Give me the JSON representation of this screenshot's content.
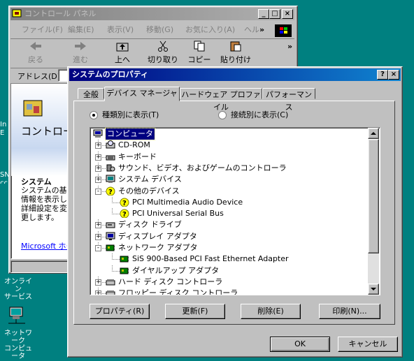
{
  "cp_window": {
    "title": "コントロール パネル",
    "menu": [
      "ファイル(F)",
      "編集(E)",
      "表示(V)",
      "移動(G)",
      "お気に入り(A)",
      "ヘル"
    ],
    "toolbar": [
      "戻る",
      "進む",
      "上へ",
      "切り取り",
      "コピー",
      "貼り付け"
    ],
    "address_label": "アドレス(D)",
    "side_title": "コントロール パネル",
    "side_heading": "システム",
    "side_text": [
      "システムの基本",
      "情報を表示し",
      "詳細設定を変",
      "更します。"
    ],
    "side_link": "Microsoft ホーム ページ"
  },
  "desktop": {
    "online_label": [
      "オンライン",
      "サービス"
    ],
    "network_label": [
      "ネットワーク",
      "コンピュータ"
    ]
  },
  "dialog": {
    "title": "システムのプロパティ",
    "tabs": [
      "全般",
      "デバイス マネージャ",
      "ハードウェア プロファイル",
      "パフォーマンス"
    ],
    "radio_by_type": "種類別に表示(T)",
    "radio_by_connection": "接続別に表示(C)",
    "tree": [
      {
        "label": "コンピュータ",
        "level": 0,
        "icon": "computer-icon",
        "selected": true
      },
      {
        "label": "CD-ROM",
        "level": 1,
        "icon": "cdrom-icon",
        "pm": "+"
      },
      {
        "label": "キーボード",
        "level": 1,
        "icon": "keyboard-icon",
        "pm": "+"
      },
      {
        "label": "サウンド、ビデオ、およびゲームのコントローラ",
        "level": 1,
        "icon": "sound-icon",
        "pm": "+"
      },
      {
        "label": "システム デバイス",
        "level": 1,
        "icon": "system-device-icon",
        "pm": "+"
      },
      {
        "label": "その他のデバイス",
        "level": 1,
        "icon": "unknown-device-icon",
        "pm": "-"
      },
      {
        "label": "PCI Multimedia Audio Device",
        "level": 2,
        "icon": "unknown-device-icon"
      },
      {
        "label": "PCI Universal Serial Bus",
        "level": 2,
        "icon": "unknown-device-icon"
      },
      {
        "label": "ディスク ドライブ",
        "level": 1,
        "icon": "disk-drive-icon",
        "pm": "+"
      },
      {
        "label": "ディスプレイ アダプタ",
        "level": 1,
        "icon": "display-icon",
        "pm": "+"
      },
      {
        "label": "ネットワーク アダプタ",
        "level": 1,
        "icon": "network-adapter-icon",
        "pm": "-"
      },
      {
        "label": "SiS 900-Based PCI Fast Ethernet Adapter",
        "level": 2,
        "icon": "network-adapter-icon"
      },
      {
        "label": "ダイヤルアップ アダプタ",
        "level": 2,
        "icon": "network-adapter-icon"
      },
      {
        "label": "ハード ディスク コントローラ",
        "level": 1,
        "icon": "disk-controller-icon",
        "pm": "+"
      },
      {
        "label": "フロッピー ディスク コントローラ",
        "level": 1,
        "icon": "disk-controller-icon",
        "pm": "+"
      }
    ],
    "buttons": {
      "properties": "プロパティ(R)",
      "refresh": "更新(F)",
      "remove": "削除(E)",
      "print": "印刷(N)...",
      "ok": "OK",
      "cancel": "キャンセル"
    }
  }
}
